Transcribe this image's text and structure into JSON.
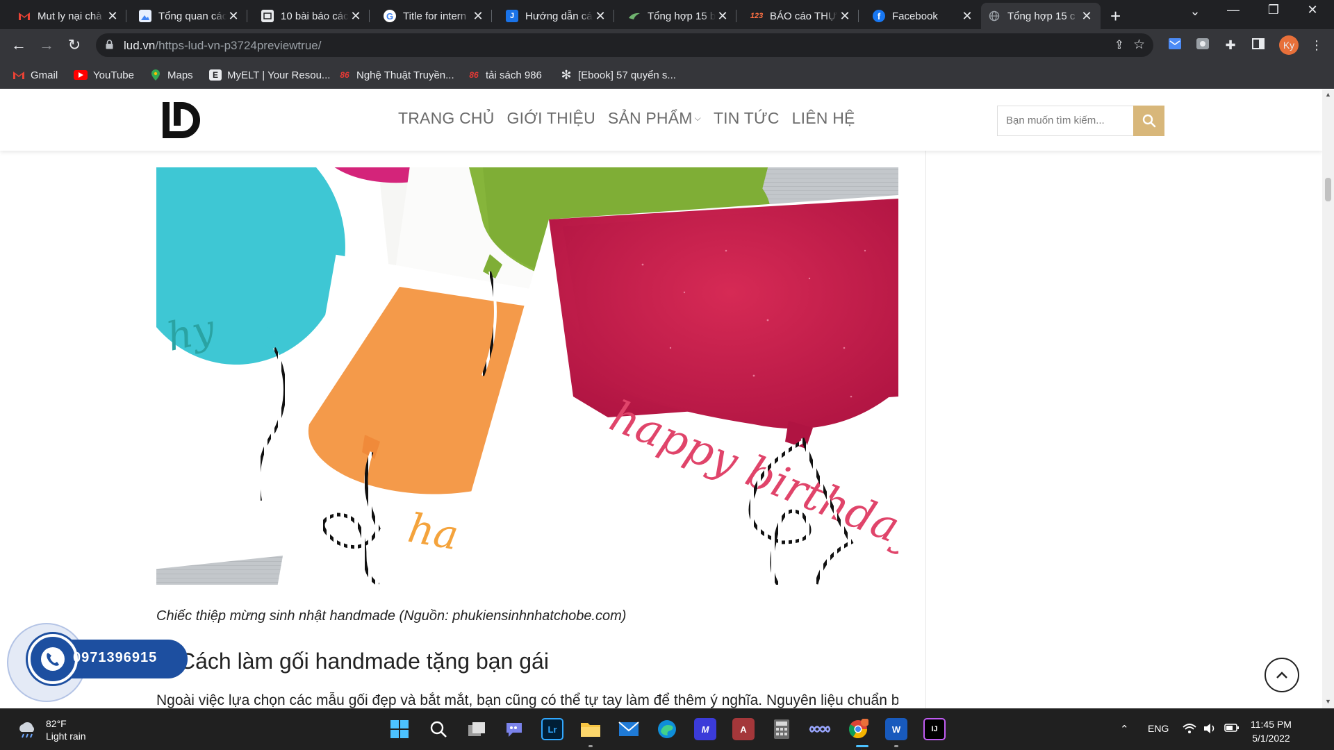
{
  "browser": {
    "tabs": [
      {
        "title": "Mut ly nại chà",
        "icon": "gmail-icon",
        "color": "#ea4335"
      },
      {
        "title": "Tổng quan các",
        "icon": "image-icon",
        "color": "#4285f4"
      },
      {
        "title": "10 bài báo các",
        "icon": "doc-icon",
        "color": "#5f6368"
      },
      {
        "title": "Title for intern",
        "icon": "google-icon",
        "color": "#ffffff"
      },
      {
        "title": "Hướng dẫn cá",
        "icon": "j-icon",
        "color": "#1a73e8"
      },
      {
        "title": "Tổng hợp 15 b",
        "icon": "bird-icon",
        "color": "#2e7d32"
      },
      {
        "title": "BÁO cáo THỰC",
        "icon": "123-icon",
        "color": "#e65100"
      },
      {
        "title": "Facebook",
        "icon": "facebook-icon",
        "color": "#1877f2"
      },
      {
        "title": "Tổng hợp 15 c",
        "icon": "globe-icon",
        "color": "#9aa0a6"
      }
    ],
    "active_tab_index": 8,
    "url_domain": "lud.vn",
    "url_path": "/https-lud-vn-p3724previewtrue/",
    "profile_initials": "Ky",
    "bookmarks": [
      {
        "label": "Gmail",
        "icon": "gmail-icon"
      },
      {
        "label": "YouTube",
        "icon": "youtube-icon"
      },
      {
        "label": "Maps",
        "icon": "maps-icon"
      },
      {
        "label": "MyELT | Your Resou...",
        "icon": "e-icon"
      },
      {
        "label": "Nghệ Thuật Truyền...",
        "icon": "86-icon"
      },
      {
        "label": "tải sách 986",
        "icon": "86-icon"
      },
      {
        "label": "[Ebook] 57 quyển s...",
        "icon": "asterisk-icon"
      }
    ]
  },
  "site": {
    "nav": [
      "TRANG CHỦ",
      "GIỚI THIỆU",
      "SẢN PHẨM",
      "TIN TỨC",
      "LIÊN HỆ"
    ],
    "search_placeholder": "Bạn muốn tìm kiếm...",
    "accent": "#d8b77a"
  },
  "article": {
    "image_text_main": "happy birthday",
    "image_text_bottom": "hap birth",
    "caption": "Chiếc thiệp mừng sinh nhật handmade (Nguồn: phukiensinhnhatchobe.com)",
    "heading": "Cách làm gối handmade tặng bạn gái",
    "paragraph": "Ngoài việc lựa chọn các mẫu gối đẹp và bắt mắt, bạn cũng có thể tự tay làm để thêm ý nghĩa. Nguyên liệu chuẩn bị"
  },
  "contact": {
    "phone": "0971396915",
    "color": "#1d4fa0"
  },
  "taskbar": {
    "weather_temp": "82°F",
    "weather_desc": "Light rain",
    "language": "ENG",
    "time": "11:45 PM",
    "date": "5/1/2022"
  }
}
